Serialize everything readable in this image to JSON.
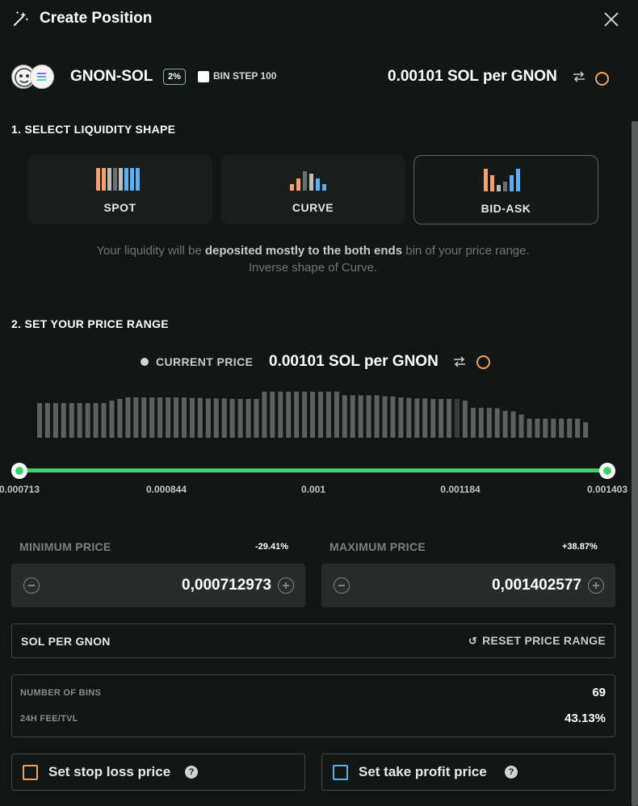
{
  "header": {
    "title": "Create Position",
    "icon": "magic-wand-icon",
    "close_icon": "close-icon"
  },
  "pair": {
    "name": "GNON-SOL",
    "fee": "2%",
    "bin_step": "BIN STEP 100",
    "price": "0.00101 SOL per GNON"
  },
  "sections": {
    "shape_title": "1. SELECT LIQUIDITY SHAPE",
    "range_title": "2. SET YOUR PRICE RANGE"
  },
  "shapes": [
    {
      "label": "SPOT",
      "selected": false
    },
    {
      "label": "CURVE",
      "selected": false
    },
    {
      "label": "BID-ASK",
      "selected": true
    }
  ],
  "shape_description": {
    "part1": "Your liquidity will be ",
    "bold": "deposited mostly to the both ends",
    "part2": " bin of your price range.",
    "line2": "Inverse shape of Curve."
  },
  "current_price": {
    "label": "CURRENT PRICE",
    "value": "0.00101 SOL per GNON"
  },
  "histogram": {
    "levels": [
      0.67,
      0.67,
      0.67,
      0.67,
      0.67,
      0.67,
      0.67,
      0.67,
      0.67,
      0.72,
      0.75,
      0.78,
      0.78,
      0.78,
      0.78,
      0.78,
      0.78,
      0.78,
      0.78,
      0.77,
      0.77,
      0.76,
      0.76,
      0.76,
      0.75,
      0.75,
      0.75,
      0.75,
      0.89,
      0.89,
      0.89,
      0.89,
      0.89,
      0.89,
      0.89,
      0.89,
      0.89,
      0.89,
      0.82,
      0.82,
      0.82,
      0.82,
      0.82,
      0.8,
      0.8,
      0.78,
      0.77,
      0.76,
      0.76,
      0.75,
      0.75,
      0.75,
      0.75,
      0.72,
      0.58,
      0.58,
      0.58,
      0.57,
      0.52,
      0.51,
      0.45,
      0.37,
      0.37,
      0.37,
      0.37,
      0.37,
      0.37,
      0.37,
      0.3
    ]
  },
  "slider": {
    "ticks": [
      "0.000713",
      "0.000844",
      "0.001",
      "0.001184",
      "0.001403"
    ]
  },
  "min_price": {
    "label": "MINIMUM PRICE",
    "pct": "-29.41%",
    "value": "0,000712973"
  },
  "max_price": {
    "label": "MAXIMUM PRICE",
    "pct": "+38.87%",
    "value": "0,001402577"
  },
  "unit_row": {
    "label": "SOL PER GNON",
    "reset": "RESET PRICE RANGE"
  },
  "stats": {
    "bins_label": "NUMBER OF BINS",
    "bins_value": "69",
    "fee_label": "24H FEE/TVL",
    "fee_value": "43.13%"
  },
  "options": {
    "stop_loss": "Set stop loss price",
    "take_profit": "Set take profit price",
    "help": "?"
  },
  "colors": {
    "accent_green": "#3ed46a",
    "orange": "#f0a060",
    "blue": "#5ab0f0",
    "bg": "#121615"
  }
}
